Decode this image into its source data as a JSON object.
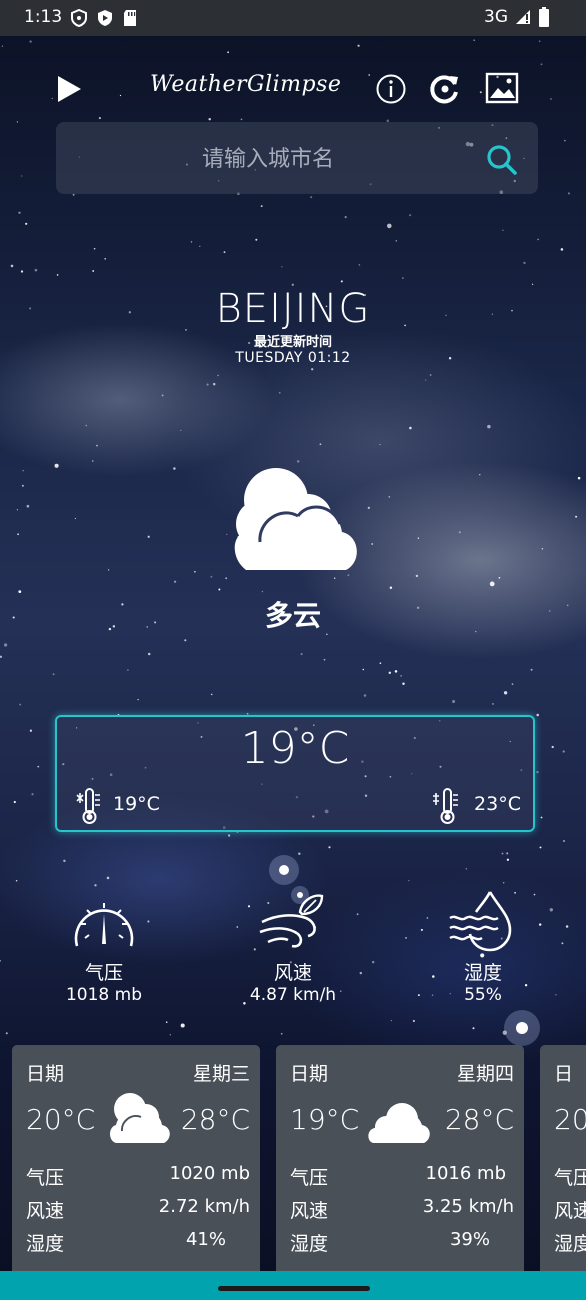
{
  "status_bar": {
    "time": "1:13",
    "network": "3G"
  },
  "app": {
    "title": "WeatherGlimpse"
  },
  "search": {
    "placeholder": "请输入城市名"
  },
  "current": {
    "city": "BEIJING",
    "updated_label": "最近更新时间",
    "updated_time": "TUESDAY 01:12",
    "condition": "多云",
    "temp": "19°C",
    "temp_min": "19°C",
    "temp_max": "23°C"
  },
  "stats": [
    {
      "label": "气压",
      "value": "1018 mb",
      "icon": "gauge-icon"
    },
    {
      "label": "风速",
      "value": "4.87 km/h",
      "icon": "wind-icon"
    },
    {
      "label": "湿度",
      "value": "55%",
      "icon": "humidity-icon"
    }
  ],
  "forecast": [
    {
      "date_label": "日期",
      "weekday": "星期三",
      "low": "20°C",
      "high": "28°C",
      "pressure_label": "气压",
      "pressure": "1020 mb",
      "wind_label": "风速",
      "wind": "2.72 km/h",
      "humidity_label": "湿度",
      "humidity": "41%"
    },
    {
      "date_label": "日期",
      "weekday": "星期四",
      "low": "19°C",
      "high": "28°C",
      "pressure_label": "气压",
      "pressure": "1016 mb",
      "wind_label": "风速",
      "wind": "3.25 km/h",
      "humidity_label": "湿度",
      "humidity": "39%"
    },
    {
      "date_label": "日",
      "weekday": "",
      "low": "20",
      "high": "",
      "pressure_label": "气压",
      "pressure": "",
      "wind_label": "风速",
      "wind": "",
      "humidity_label": "湿度",
      "humidity": ""
    }
  ],
  "colors": {
    "accent": "#27c4cc",
    "card": "#4a5058",
    "bottom_bar": "#00a3ae"
  }
}
